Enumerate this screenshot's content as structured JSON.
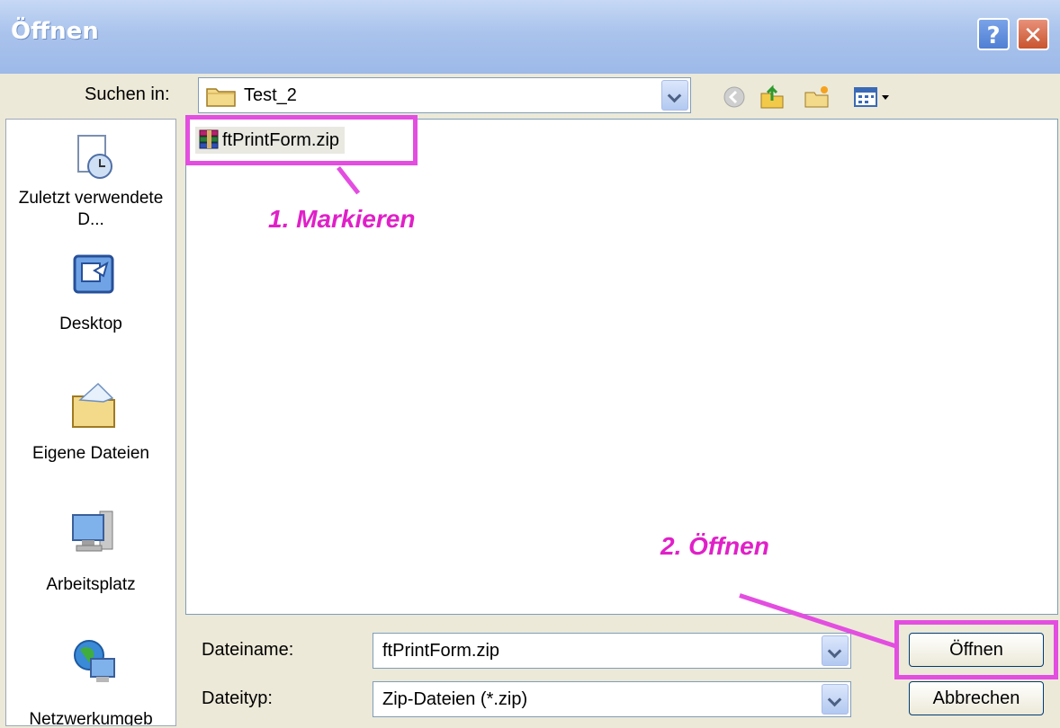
{
  "window": {
    "title": "Öffnen",
    "help_label": "?",
    "close_label": "✕"
  },
  "toolbar": {
    "look_in_label": "Suchen in:",
    "look_in_value": "Test_2",
    "icons": [
      "back-icon",
      "up-folder-icon",
      "new-folder-icon",
      "view-menu-icon"
    ]
  },
  "places": [
    {
      "label": "Zuletzt verwendete D...",
      "icon": "recent-documents-icon"
    },
    {
      "label": "Desktop",
      "icon": "desktop-icon"
    },
    {
      "label": "Eigene Dateien",
      "icon": "my-documents-icon"
    },
    {
      "label": "Arbeitsplatz",
      "icon": "my-computer-icon"
    },
    {
      "label": "Netzwerkumgeb",
      "icon": "network-places-icon"
    }
  ],
  "files": [
    {
      "name": "ftPrintForm.zip",
      "icon": "winrar-archive-icon",
      "selected": true
    }
  ],
  "form": {
    "filename_label": "Dateiname:",
    "filename_value": "ftPrintForm.zip",
    "filetype_label": "Dateityp:",
    "filetype_value": "Zip-Dateien (*.zip)",
    "open_label": "Öffnen",
    "cancel_label": "Abbrechen"
  },
  "annotations": {
    "step1": "1. Markieren",
    "step2": "2. Öffnen",
    "color": "#e34ee0"
  }
}
